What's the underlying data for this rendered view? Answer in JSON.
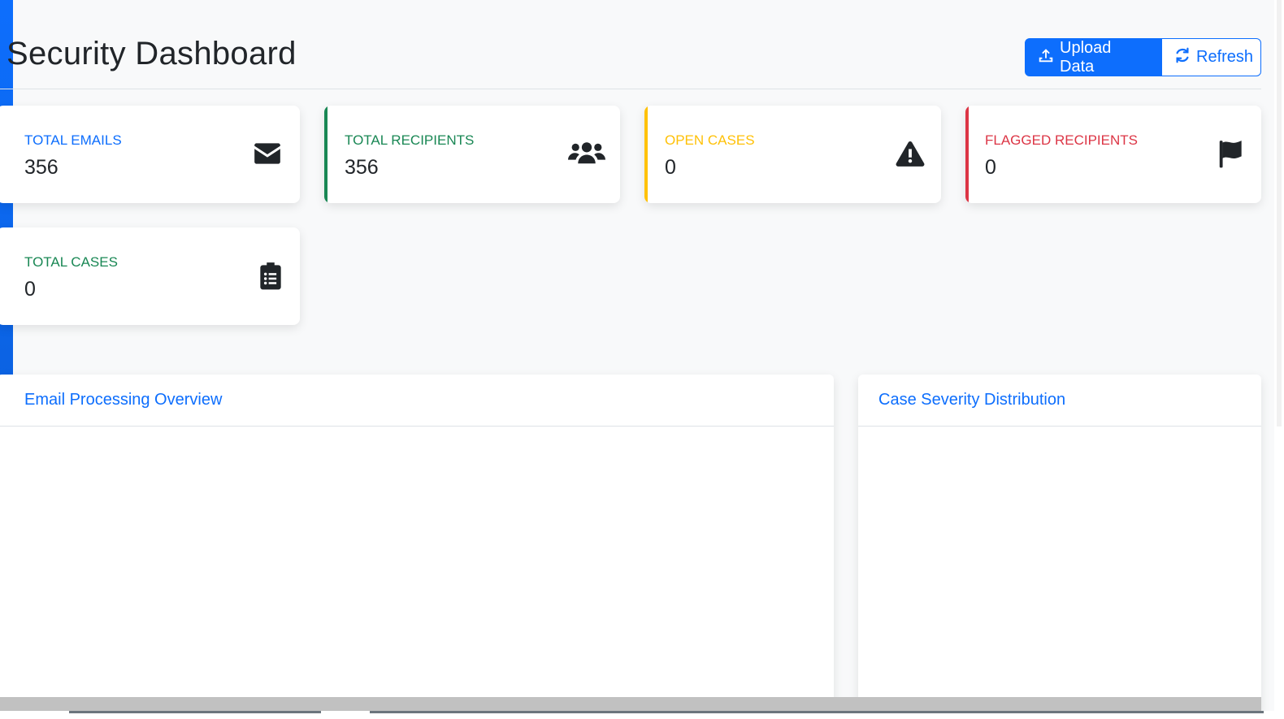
{
  "header": {
    "title": "Security Dashboard",
    "upload_label": "Upload Data",
    "refresh_label": "Refresh"
  },
  "stats": [
    {
      "label": "TOTAL EMAILS",
      "value": "356",
      "color": "#0d6efd",
      "icon": "envelope-icon"
    },
    {
      "label": "TOTAL RECIPIENTS",
      "value": "356",
      "color": "#198754",
      "icon": "users-icon"
    },
    {
      "label": "OPEN CASES",
      "value": "0",
      "color": "#ffc107",
      "icon": "warning-icon"
    },
    {
      "label": "FLAGGED RECIPIENTS",
      "value": "0",
      "color": "#dc3545",
      "icon": "flag-icon"
    },
    {
      "label": "TOTAL CASES",
      "value": "0",
      "color": "#198754",
      "icon": "clipboard-list-icon"
    }
  ],
  "panels": {
    "email_overview_title": "Email Processing Overview",
    "severity_title": "Case Severity Distribution"
  },
  "colors": {
    "primary": "#0d6efd",
    "success": "#198754",
    "warning": "#ffc107",
    "danger": "#dc3545"
  }
}
